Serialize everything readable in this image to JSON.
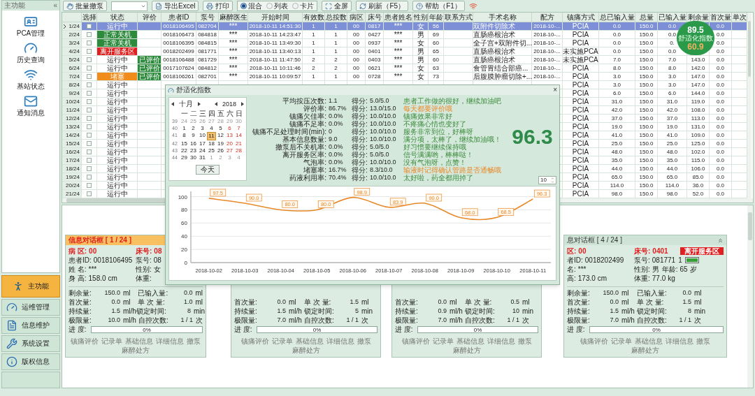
{
  "sidebar": {
    "title": "主功能",
    "collapse": "«",
    "shortcuts": [
      {
        "label": "PCA管理"
      },
      {
        "label": "历史查询"
      },
      {
        "label": "基站状态"
      },
      {
        "label": "通知消息"
      }
    ],
    "nav": [
      {
        "label": "主功能",
        "selected": true
      },
      {
        "label": "运维管理",
        "selected": false
      },
      {
        "label": "信息维护",
        "selected": false
      },
      {
        "label": "系统设置",
        "selected": false
      },
      {
        "label": "版权信息",
        "selected": false
      }
    ]
  },
  "toolbar": {
    "items": [
      {
        "kind": "button",
        "label": "批量撤泵"
      },
      {
        "kind": "dropdown"
      },
      {
        "kind": "button",
        "label": "导出Excel"
      },
      {
        "kind": "button",
        "label": "打印"
      },
      {
        "kind": "radio",
        "options": [
          {
            "label": "混合",
            "selected": true
          },
          {
            "label": "列表",
            "selected": false
          },
          {
            "label": "卡片",
            "selected": false
          }
        ]
      },
      {
        "kind": "button",
        "label": "全屏"
      },
      {
        "kind": "button",
        "label": "刷新（F5）"
      },
      {
        "kind": "button",
        "label": "帮助（F1）"
      },
      {
        "kind": "signal"
      }
    ]
  },
  "table": {
    "columns": [
      "选择",
      "状态",
      "评价",
      "患者ID",
      "泵号",
      "麻醉医生",
      "开始时间",
      "有效数",
      "总按数",
      "病区",
      "床号",
      "患者姓名",
      "性别",
      "年龄",
      "联系方式",
      "手术名称",
      "配方",
      "镇痛方式",
      "总已输入量",
      "总量",
      "已输入量",
      "剩余量",
      "首次量",
      "单次"
    ],
    "rows": [
      {
        "no": "1/24",
        "selected": true,
        "checked": false,
        "status": "运行中",
        "pid": "0018106495",
        "pump": "082704",
        "doctor": "***",
        "start": "2018-10-11 14:51:30",
        "valid": "1",
        "presses": "1",
        "ward": "00",
        "bed": "0817",
        "pname": "***",
        "sex": "女",
        "age": "56",
        "surgery": "双附件切除术",
        "formula": "2018-10-...",
        "mode": "PCIA",
        "total_in": "0.0",
        "total": "150.0",
        "infused": "0.0",
        "first": "0.0"
      },
      {
        "no": "2/24",
        "selected": false,
        "checked": false,
        "status": "正常关机",
        "color": "#2e8b3e",
        "pid": "0018106473",
        "pump": "084818",
        "doctor": "***",
        "start": "2018-10-11 14:23:47",
        "valid": "1",
        "presses": "1",
        "ward": "00",
        "bed": "0427",
        "pname": "***",
        "sex": "男",
        "age": "69",
        "surgery": "直肠癌根治术",
        "formula": "2018-10-...",
        "mode": "PCIA",
        "total_in": "0.0",
        "total": "150.0",
        "infused": "0.0",
        "first": "0.0"
      },
      {
        "no": "3/24",
        "selected": false,
        "checked": false,
        "status": "正常关机",
        "color": "#2e8b3e",
        "pid": "0018106395",
        "pump": "084815",
        "doctor": "***",
        "start": "2018-10-11 13:49:30",
        "valid": "1",
        "presses": "1",
        "ward": "00",
        "bed": "0937",
        "pname": "***",
        "sex": "女",
        "age": "60",
        "surgery": "全子宫+双附件切...",
        "formula": "2018-10-...",
        "mode": "PCIA",
        "total_in": "0.0",
        "total": "150.0",
        "infused": "0.",
        "first": "0.0"
      },
      {
        "no": "4/24",
        "selected": false,
        "checked": false,
        "status": "离开服务区",
        "color": "#e02020",
        "pid": "0018202499",
        "pump": "081771",
        "doctor": "***",
        "start": "2018-10-11 13:40:13",
        "valid": "1",
        "presses": "1",
        "ward": "00",
        "bed": "0401",
        "pname": "***",
        "sex": "男",
        "age": "65",
        "surgery": "直肠癌根治术",
        "formula": "2018-10-...",
        "mode": "未实施PCA",
        "total_in": "0.0",
        "total": "150.0",
        "infused": "0.0",
        "first": "0.0"
      },
      {
        "no": "5/24",
        "selected": false,
        "checked": false,
        "status": "运行中",
        "eval": "已评价",
        "pid": "0018106488",
        "pump": "081729",
        "doctor": "***",
        "start": "2018-10-11 11:47:50",
        "valid": "2",
        "presses": "2",
        "ward": "00",
        "bed": "0403",
        "pname": "***",
        "sex": "男",
        "age": "60",
        "surgery": "直肠癌根治术",
        "formula": "2018-10-...",
        "mode": "未实施PCA",
        "total_in": "7.0",
        "total": "150.0",
        "infused": "7.0",
        "remaining": "143.0",
        "first": "0.0"
      },
      {
        "no": "6/24",
        "selected": false,
        "checked": false,
        "status": "运行中",
        "eval": "已评价",
        "pid": "0017107624",
        "pump": "084812",
        "doctor": "***",
        "start": "2018-10-11 10:11:46",
        "valid": "2",
        "presses": "2",
        "ward": "00",
        "bed": "0621",
        "pname": "***",
        "sex": "女",
        "age": "63",
        "surgery": "食管胃结合部癌...",
        "formula": "2018-10-...",
        "mode": "PCIA",
        "total_in": "8.0",
        "total": "150.0",
        "infused": "8.0",
        "remaining": "142.0",
        "first": "0.0"
      },
      {
        "no": "7/24",
        "selected": false,
        "checked": false,
        "status": "堵塞",
        "color": "#f08c1c",
        "eval": "已评价",
        "pid": "0018106261",
        "pump": "082701",
        "doctor": "***",
        "start": "2018-10-11 10:09:57",
        "valid": "1",
        "presses": "1",
        "ward": "00",
        "bed": "0728",
        "pname": "***",
        "sex": "女",
        "age": "73",
        "surgery": "后腹膜肿瘤切除+...",
        "formula": "2018-10-...",
        "mode": "PCIA",
        "total_in": "3.0",
        "total": "150.0",
        "infused": "3.0",
        "remaining": "147.0",
        "first": "0.0"
      },
      {
        "no": "8/24",
        "selected": false,
        "checked": false,
        "status": "运行中",
        "mode": "PCIA",
        "total_in": "3.0",
        "total": "150.0",
        "infused": "3.0",
        "remaining": "147.0",
        "first": "0.0"
      },
      {
        "no": "9/24",
        "selected": false,
        "checked": false,
        "status": "运行中",
        "mode": "PCIA",
        "total_in": "6.0",
        "total": "150.0",
        "infused": "6.0",
        "remaining": "144.0",
        "first": "0.0"
      },
      {
        "no": "10/24",
        "selected": false,
        "checked": false,
        "status": "运行中",
        "mode": "PCIA",
        "total_in": "31.0",
        "total": "150.0",
        "infused": "31.0",
        "remaining": "119.0",
        "first": "0.0"
      },
      {
        "no": "11/24",
        "selected": false,
        "checked": false,
        "status": "运行中",
        "mode": "PCIA",
        "total_in": "42.0",
        "total": "150.0",
        "infused": "42.0",
        "remaining": "108.0",
        "first": "0.0"
      },
      {
        "no": "12/24",
        "selected": false,
        "checked": false,
        "status": "运行中",
        "mode": "PCIA",
        "total_in": "37.0",
        "total": "150.0",
        "infused": "37.0",
        "remaining": "113.0",
        "first": "0.0"
      },
      {
        "no": "13/24",
        "selected": false,
        "checked": false,
        "status": "运行中",
        "mode": "PCIA",
        "total_in": "19.0",
        "total": "150.0",
        "infused": "19.0",
        "remaining": "131.0",
        "first": "0.0"
      },
      {
        "no": "14/24",
        "selected": false,
        "checked": false,
        "status": "运行中",
        "mode": "PCIA",
        "total_in": "41.0",
        "total": "150.0",
        "infused": "41.0",
        "remaining": "109.0",
        "first": "0.0"
      },
      {
        "no": "15/24",
        "selected": false,
        "checked": false,
        "status": "运行中",
        "mode": "PCIA",
        "total_in": "25.0",
        "total": "150.0",
        "infused": "25.0",
        "remaining": "125.0",
        "first": "0.0"
      },
      {
        "no": "16/24",
        "selected": false,
        "checked": false,
        "status": "运行中",
        "mode": "PCIA",
        "total_in": "48.0",
        "total": "150.0",
        "infused": "48.0",
        "remaining": "102.0",
        "first": "0.0"
      },
      {
        "no": "17/24",
        "selected": false,
        "checked": false,
        "status": "运行中",
        "mode": "PCIA",
        "total_in": "35.0",
        "total": "150.0",
        "infused": "35.0",
        "remaining": "115.0",
        "first": "0.0"
      },
      {
        "no": "18/24",
        "selected": false,
        "checked": false,
        "status": "运行中",
        "mode": "PCIA",
        "total_in": "44.0",
        "total": "150.0",
        "infused": "44.0",
        "remaining": "106.0",
        "first": "0.0"
      },
      {
        "no": "19/24",
        "selected": false,
        "checked": false,
        "status": "运行中",
        "mode": "PCIA",
        "total_in": "65.0",
        "total": "150.0",
        "infused": "65.0",
        "remaining": "85.0",
        "first": "0.0"
      },
      {
        "no": "20/24",
        "selected": false,
        "checked": false,
        "status": "运行中",
        "mode": "PCIA",
        "total_in": "114.0",
        "total": "150.0",
        "infused": "114.0",
        "remaining": "36.0",
        "first": "0.0"
      },
      {
        "no": "21/24",
        "selected": false,
        "checked": false,
        "status": "运行中",
        "mode": "PCIA",
        "total_in": "98.0",
        "total": "150.0",
        "infused": "98.0",
        "remaining": "52.0",
        "first": "0.0"
      }
    ]
  },
  "comfort_badge": {
    "score": "89.5",
    "label": "舒适化指数",
    "previous": "60.9"
  },
  "comfort_dialog": {
    "title": "舒适化指数",
    "close": "×",
    "calendar": {
      "month": "十月",
      "year": "2018",
      "weekdays": [
        "一",
        "二",
        "三",
        "四",
        "五",
        "六",
        "日"
      ],
      "weeks": [
        {
          "week": "39",
          "days": [
            {
              "day": "24",
              "other": true,
              "selected": false
            },
            {
              "day": "25",
              "other": true,
              "selected": false
            },
            {
              "day": "26",
              "other": true,
              "selected": false
            },
            {
              "day": "27",
              "other": true,
              "selected": false
            },
            {
              "day": "28",
              "other": true,
              "selected": false
            },
            {
              "day": "29",
              "other": true,
              "selected": false
            },
            {
              "day": "30",
              "other": true,
              "selected": false
            }
          ]
        },
        {
          "week": "40",
          "days": [
            {
              "day": "1",
              "other": false,
              "selected": false
            },
            {
              "day": "2",
              "other": false,
              "selected": false
            },
            {
              "day": "3",
              "other": false,
              "selected": false
            },
            {
              "day": "4",
              "other": false,
              "selected": false
            },
            {
              "day": "5",
              "other": false,
              "selected": false
            },
            {
              "day": "6",
              "other": false,
              "selected": false
            },
            {
              "day": "7",
              "other": false,
              "selected": false
            }
          ]
        },
        {
          "week": "41",
          "days": [
            {
              "day": "8",
              "other": false,
              "selected": false
            },
            {
              "day": "9",
              "other": false,
              "selected": false
            },
            {
              "day": "10",
              "other": false,
              "selected": false
            },
            {
              "day": "11",
              "other": false,
              "selected": true
            },
            {
              "day": "12",
              "other": false,
              "selected": false
            },
            {
              "day": "13",
              "other": false,
              "selected": false
            },
            {
              "day": "14",
              "other": false,
              "selected": false
            }
          ]
        },
        {
          "week": "42",
          "days": [
            {
              "day": "15",
              "other": false,
              "selected": false
            },
            {
              "day": "16",
              "other": false,
              "selected": false
            },
            {
              "day": "17",
              "other": false,
              "selected": false
            },
            {
              "day": "18",
              "other": false,
              "selected": false
            },
            {
              "day": "19",
              "other": false,
              "selected": false
            },
            {
              "day": "20",
              "other": false,
              "selected": false
            },
            {
              "day": "21",
              "other": false,
              "selected": false
            }
          ]
        },
        {
          "week": "43",
          "days": [
            {
              "day": "22",
              "other": false,
              "selected": false
            },
            {
              "day": "23",
              "other": false,
              "selected": false
            },
            {
              "day": "24",
              "other": false,
              "selected": false
            },
            {
              "day": "25",
              "other": false,
              "selected": false
            },
            {
              "day": "26",
              "other": false,
              "selected": false
            },
            {
              "day": "27",
              "other": false,
              "selected": false
            },
            {
              "day": "28",
              "other": false,
              "selected": false
            }
          ]
        },
        {
          "week": "44",
          "days": [
            {
              "day": "29",
              "other": false,
              "selected": false
            },
            {
              "day": "30",
              "other": false,
              "selected": false
            },
            {
              "day": "31",
              "other": false,
              "selected": false
            },
            {
              "day": "1",
              "other": true,
              "selected": false
            },
            {
              "day": "2",
              "other": true,
              "selected": false
            },
            {
              "day": "3",
              "other": true,
              "selected": false
            },
            {
              "day": "4",
              "other": true,
              "selected": false
            }
          ]
        }
      ],
      "today_button": "今天"
    },
    "metrics": [
      {
        "label": "平均按压次数:",
        "value": "1.1",
        "score_label": "得分:",
        "score": "5.0/5.0",
        "comment": "患者工作做的很好，继续加油吧",
        "warning": false
      },
      {
        "label": "评价率:",
        "value": "86.7%",
        "score_label": "得分:",
        "score": "13.0/15.0",
        "comment": "每天都要评价哦",
        "warning": true
      },
      {
        "label": "镇痛欠佳率:",
        "value": "0.0%",
        "score_label": "得分:",
        "score": "10.0/10.0",
        "comment": "镇痛效果非常好",
        "warning": false
      },
      {
        "label": "镇痛不足率:",
        "value": "0.0%",
        "score_label": "得分:",
        "score": "10.0/10.0",
        "comment": "不疼痛心情也变好了",
        "warning": false
      },
      {
        "label": "镇痛不足处理时间(min):",
        "value": "0",
        "score_label": "得分:",
        "score": "10.0/10.0",
        "comment": "服务非常到位，好棒呀",
        "warning": false
      },
      {
        "label": "基本信息数量:",
        "value": "9.0",
        "score_label": "得分:",
        "score": "10.0/10.0",
        "comment": "满分项，太棒了，继续加油哦！",
        "warning": false
      },
      {
        "label": "撤泵后不关机率:",
        "value": "0.0%",
        "score_label": "得分:",
        "score": "5.0/5.0",
        "comment": "好习惯要继续保持哦",
        "warning": false
      },
      {
        "label": "离开服务区率:",
        "value": "0.0%",
        "score_label": "得分:",
        "score": "5.0/5.0",
        "comment": "信号满满哟，棒棒哒！",
        "warning": false
      },
      {
        "label": "气泡率:",
        "value": "0.0%",
        "score_label": "得分:",
        "score": "10.0/10.0",
        "comment": "没有气泡呀，点赞！",
        "warning": false
      },
      {
        "label": "堵塞率:",
        "value": "16.7%",
        "score_label": "得分:",
        "score": "8.3/10.0",
        "comment": "输液时记得确认管路是否通畅哦",
        "warning": true
      },
      {
        "label": "药液利用率:",
        "value": "70.4%",
        "score_label": "得分:",
        "score": "10.0/10.0",
        "comment": "太好啦，药全都用掉了",
        "warning": false
      }
    ],
    "total": "96.3",
    "days_spinner": "10",
    "chart_data": {
      "type": "line",
      "grid": true,
      "categories": [
        "2018-10-02",
        "2018-10-03",
        "2018-10-04",
        "2018-10-05",
        "2018-10-06",
        "2018-10-07",
        "2018-10-08",
        "2018-10-09",
        "2018-10-10",
        "2018-10-11"
      ],
      "series": [
        {
          "color": "#e8892a",
          "values": [
            97.5,
            90.0,
            80.0,
            80.0,
            98.9,
            83.9,
            90.0,
            68.0,
            68.5,
            96.3
          ]
        }
      ],
      "ylim": [
        0,
        108
      ],
      "yticks": [
        0,
        20,
        40,
        60,
        80,
        100
      ],
      "value_labels": [
        "97.5",
        "90.0",
        "80.0",
        "80.0",
        "98.9",
        "83.9",
        "90.0",
        "68.0",
        "68.5",
        "96.3"
      ]
    }
  },
  "cards": [
    {
      "title": "信息对话框 [ 1 / 24 ]",
      "selected": true,
      "top_rows": [
        {
          "kind": "alert",
          "items": [
            {
              "label": "病 区:",
              "value": "00"
            },
            {
              "label": "床号:",
              "value": "08"
            }
          ]
        },
        {
          "kind": "info",
          "items": [
            {
              "label": "患者ID:",
              "value": "0018106495"
            },
            {
              "label": "泵号:",
              "value": "08"
            }
          ]
        },
        {
          "kind": "info",
          "items": [
            {
              "label": "姓 名:",
              "value": "***"
            },
            {
              "label": "性别:",
              "value": "女"
            }
          ]
        },
        {
          "kind": "info",
          "items": [
            {
              "label": "身 高:",
              "value": "158.0",
              "unit": "cm"
            },
            {
              "label": "体重:"
            }
          ]
        }
      ],
      "rows": [
        [
          {
            "label": "剩余量:",
            "value": "150.0",
            "unit": "ml"
          },
          {
            "label": "已输入量:",
            "value": "0.0",
            "unit": "ml"
          }
        ],
        [
          {
            "label": "首次量:",
            "value": "0.0",
            "unit": "ml"
          },
          {
            "label": "单 次 量:",
            "value": "1.0",
            "unit": "ml"
          }
        ],
        [
          {
            "label": "持续量:",
            "value": "1.5",
            "unit": "ml/h"
          },
          {
            "label": "锁定时间:",
            "value": "8",
            "unit": "min"
          }
        ],
        [
          {
            "label": "极限量:",
            "value": "10.0",
            "unit": "ml/h"
          },
          {
            "label": "自控次数:",
            "value": "1 / 1",
            "unit": "次"
          }
        ]
      ],
      "progress": {
        "label": "进 度:",
        "level": 0,
        "text": "0%"
      },
      "actions": [
        "镇痛评价",
        "记录单",
        "基础信息",
        "详细信息",
        "撤泵",
        "麻醉处方"
      ]
    },
    {
      "rows": [
        [
          {
            "label": "首次量:",
            "value": "0.0",
            "unit": "ml"
          },
          {
            "label": "单 次 量:",
            "value": "1.5",
            "unit": "ml"
          }
        ],
        [
          {
            "label": "持续量:",
            "value": "1.5",
            "unit": "ml/h"
          },
          {
            "label": "锁定时间:",
            "value": "5",
            "unit": "min"
          }
        ],
        [
          {
            "label": "极限量:",
            "value": "7.0",
            "unit": "ml/h"
          },
          {
            "label": "自控次数:",
            "value": "1 / 1",
            "unit": "次"
          }
        ]
      ],
      "progress": {
        "label": "进 度:",
        "level": 0,
        "text": "0%"
      },
      "actions": [
        "镇痛评价",
        "记录单",
        "基础信息",
        "详细信息",
        "撤泵",
        "麻醉处方"
      ]
    },
    {
      "rows": [
        [
          {
            "label": "首次量:",
            "value": "0.0",
            "unit": "ml"
          },
          {
            "label": "单 次 量:",
            "value": "0.5",
            "unit": "ml"
          }
        ],
        [
          {
            "label": "持续量:",
            "value": "0.9",
            "unit": "ml/h"
          },
          {
            "label": "锁定时间:",
            "value": "10",
            "unit": "min"
          }
        ],
        [
          {
            "label": "极限量:",
            "value": "7.0",
            "unit": "ml/h"
          },
          {
            "label": "自控次数:",
            "value": "1 / 1",
            "unit": "次"
          }
        ]
      ],
      "progress": {
        "label": "进 度:",
        "level": 0,
        "text": "0%"
      },
      "actions": [
        "镇痛评价",
        "记录单",
        "基础信息",
        "详细信息",
        "撤泵",
        "麻醉处方"
      ]
    },
    {
      "title": "息对话框 [ 4 / 24 ]",
      "selected": false,
      "top_rows": [
        {
          "kind": "alert",
          "items": [
            {
              "label": "区:",
              "value": "00"
            },
            {
              "label": "床号:",
              "value": "0401"
            },
            {
              "kind": "badge",
              "value": "离开服务区"
            }
          ]
        },
        {
          "kind": "info",
          "items": [
            {
              "label": "者ID:",
              "value": "0018202499"
            },
            {
              "label": "泵号:",
              "value": "081771"
            },
            {
              "value": "1"
            },
            {
              "kind": "battery"
            }
          ]
        },
        {
          "kind": "info",
          "items": [
            {
              "label": "名:",
              "value": "***"
            },
            {
              "label": "性别:",
              "value": "男"
            },
            {
              "label": "年龄:",
              "value": "65",
              "unit": "岁"
            }
          ]
        },
        {
          "kind": "info",
          "items": [
            {
              "label": "高:",
              "value": "173.0",
              "unit": "cm"
            },
            {
              "label": "体重:",
              "value": "77.0",
              "unit": "kg"
            }
          ]
        }
      ],
      "rows": [
        [
          {
            "label": "剩余量:",
            "value": "150.0",
            "unit": "ml"
          },
          {
            "label": "已输入量:",
            "value": "0.0",
            "unit": "ml"
          }
        ],
        [
          {
            "label": "首次量:",
            "value": "0.0",
            "unit": "ml"
          },
          {
            "label": "单 次 量:",
            "value": "1.5",
            "unit": "ml"
          }
        ],
        [
          {
            "label": "持续量:",
            "value": "1.5",
            "unit": "ml/h"
          },
          {
            "label": "锁定时间:",
            "value": "8",
            "unit": "min"
          }
        ],
        [
          {
            "label": "极限量:",
            "value": "7.0",
            "unit": "ml/h"
          },
          {
            "label": "自控次数:",
            "value": "1 / 1",
            "unit": "次"
          }
        ]
      ],
      "progress": {
        "label": "进 度:",
        "level": 0,
        "text": "0%"
      },
      "actions": [
        "镇痛评价",
        "记录单",
        "基础信息",
        "详细信息",
        "撤泵",
        "麻醉处方"
      ]
    }
  ]
}
